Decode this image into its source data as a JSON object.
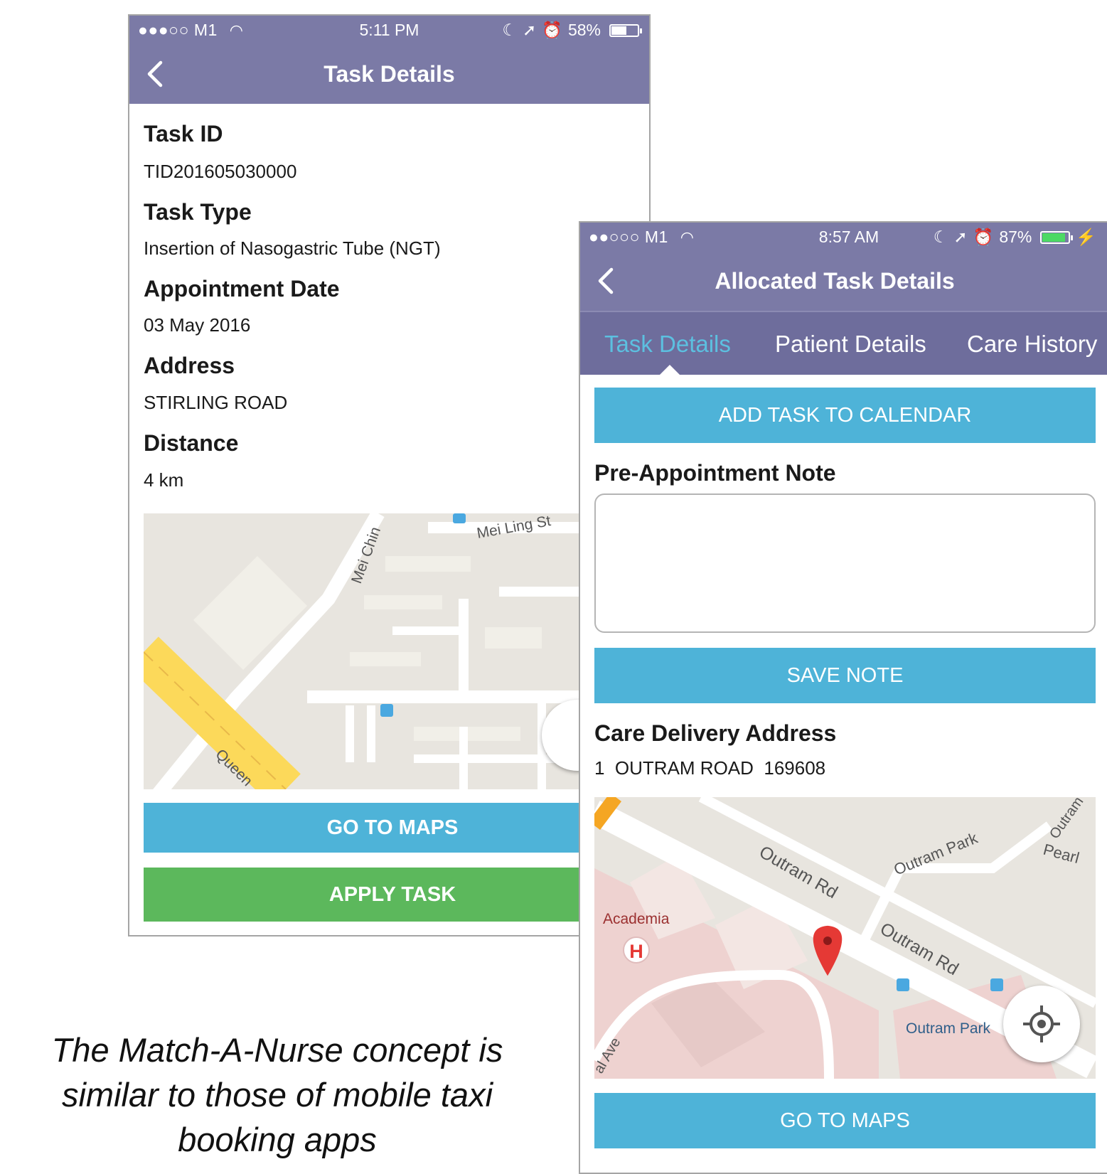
{
  "phone1": {
    "status": {
      "carrier": "●●●○○ M1",
      "time": "5:11 PM",
      "battery": "58%",
      "battery_level": 0.58
    },
    "header": {
      "title": "Task Details"
    },
    "fields": [
      {
        "label": "Task ID",
        "value": "TID201605030000"
      },
      {
        "label": "Task Type",
        "value": "Insertion of Nasogastric Tube (NGT)"
      },
      {
        "label": "Appointment Date",
        "value": "03 May 2016"
      },
      {
        "label": "Address",
        "value": "STIRLING ROAD"
      },
      {
        "label": "Distance",
        "value": "4 km"
      }
    ],
    "map": {
      "labels": {
        "mei_chin": "Mei Chin",
        "mei_ling": "Mei Ling St",
        "queen": "Queen"
      }
    },
    "buttons": {
      "go_to_maps": "GO TO MAPS",
      "apply_task": "APPLY TASK"
    }
  },
  "phone2": {
    "status": {
      "carrier": "●●○○○ M1",
      "time": "8:57 AM",
      "battery": "87%",
      "battery_level": 0.87
    },
    "header": {
      "title": "Allocated Task Details"
    },
    "tabs": [
      {
        "label": "Task Details",
        "active": true
      },
      {
        "label": "Patient Details",
        "active": false
      },
      {
        "label": "Care History",
        "active": false
      }
    ],
    "buttons": {
      "add_to_calendar": "ADD TASK TO CALENDAR",
      "save_note": "SAVE NOTE",
      "go_to_maps": "GO TO MAPS"
    },
    "note": {
      "label": "Pre-Appointment Note",
      "value": ""
    },
    "address": {
      "label": "Care Delivery Address",
      "value": "1  OUTRAM ROAD  169608"
    },
    "map": {
      "labels": {
        "outram_rd_1": "Outram Rd",
        "outram_rd_2": "Outram Rd",
        "outram_park_road": "Outram Park",
        "outram_park_station": "Outram Park",
        "academia": "Academia",
        "hospital": "H",
        "pearl": "Pearl",
        "outram_edge": "Outram",
        "ave": "al Ave"
      }
    }
  },
  "caption": {
    "line1": "The Match-A-Nurse concept is",
    "line2": "similar to those of mobile taxi",
    "line3": "booking apps"
  },
  "colors": {
    "header": "#7b7aa6",
    "tabs": "#6e6d9c",
    "blue_button": "#4eb3d8",
    "green_button": "#5cb85c",
    "active_tab": "#5cc0e0"
  }
}
